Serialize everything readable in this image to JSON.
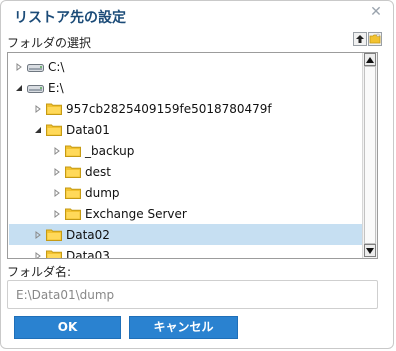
{
  "dialog": {
    "title": "リストア先の設定",
    "close_icon": "close-icon",
    "folder_section_label": "フォルダの選択"
  },
  "header_icons": [
    "folder-up-icon",
    "new-folder-icon"
  ],
  "tree": {
    "selected_index": 8,
    "rows": [
      {
        "label": "C:\\",
        "type": "drive",
        "level": 0,
        "expander": "collapsed"
      },
      {
        "label": "E:\\",
        "type": "drive",
        "level": 0,
        "expander": "expanded"
      },
      {
        "label": "957cb2825409159fe5018780479f",
        "type": "folder",
        "level": 1,
        "expander": "collapsed"
      },
      {
        "label": "Data01",
        "type": "folder",
        "level": 1,
        "expander": "expanded"
      },
      {
        "label": "_backup",
        "type": "folder",
        "level": 2,
        "expander": "collapsed"
      },
      {
        "label": "dest",
        "type": "folder",
        "level": 2,
        "expander": "collapsed"
      },
      {
        "label": "dump",
        "type": "folder",
        "level": 2,
        "expander": "collapsed"
      },
      {
        "label": "Exchange Server",
        "type": "folder",
        "level": 2,
        "expander": "collapsed"
      },
      {
        "label": "Data02",
        "type": "folder",
        "level": 1,
        "expander": "collapsed"
      },
      {
        "label": "Data03",
        "type": "folder",
        "level": 1,
        "expander": "collapsed"
      }
    ]
  },
  "folder_name": {
    "label": "フォルダ名:",
    "value": "E:\\Data01\\dump",
    "placeholder": ""
  },
  "buttons": {
    "ok": "OK",
    "cancel": "キャンセル"
  },
  "colors": {
    "title": "#1b4b78",
    "selection": "#c6dff2",
    "button": "#2a82d0",
    "folder": "#f2c230"
  }
}
